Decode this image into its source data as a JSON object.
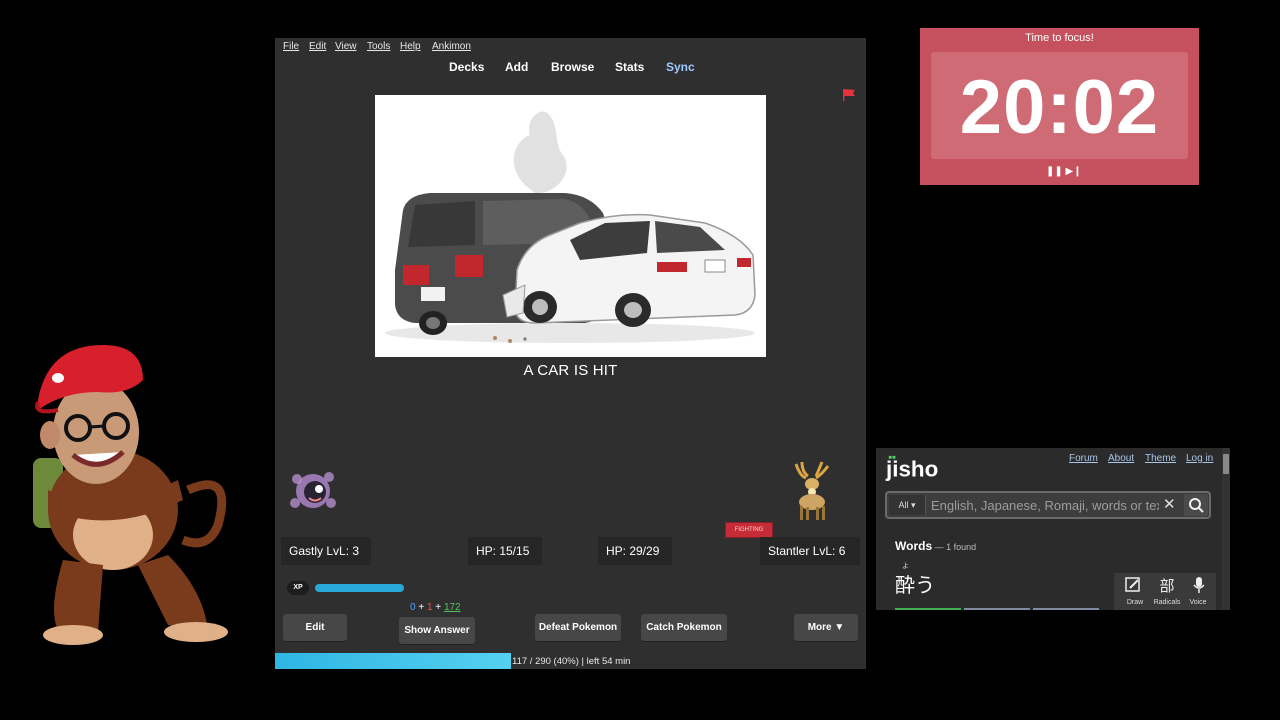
{
  "anki": {
    "menu": [
      "File",
      "Edit",
      "View",
      "Tools",
      "Help",
      "Ankimon"
    ],
    "toolbar": {
      "decks": "Decks",
      "add": "Add",
      "browse": "Browse",
      "stats": "Stats",
      "sync": "Sync"
    },
    "card_text": "A CAR IS HIT",
    "battle": {
      "player_pokemon": "Gastly LvL: 3",
      "player_hp": "HP: 15/15",
      "enemy_hp": "HP: 29/29",
      "enemy_pokemon": "Stantler LvL: 6",
      "enemy_type": "FIGHTING",
      "xp_label": "XP",
      "xp_fraction": 0.85
    },
    "counts": {
      "new": "0",
      "sep1": " + ",
      "learn": "1",
      "sep2": " + ",
      "review": "172"
    },
    "buttons": {
      "edit": "Edit",
      "show_answer": "Show Answer",
      "defeat": "Defeat Pokemon",
      "catch": "Catch Pokemon",
      "more": "More ▼"
    },
    "progress": {
      "text": "117 / 290 (40%) | left 54 min",
      "fraction": 0.4
    }
  },
  "timer": {
    "title": "Time to focus!",
    "time": "20:02",
    "controls": "❚❚ ▶❙"
  },
  "jisho": {
    "logo": "jisho",
    "links": {
      "forum": "Forum",
      "about": "About",
      "theme": "Theme",
      "login": "Log in"
    },
    "search": {
      "scope": "All ▾",
      "placeholder": "English, Japanese, Romaji, words or text"
    },
    "words_label": "Words",
    "found": " — 1 found",
    "furigana": "よ",
    "word": "酔う",
    "tools": {
      "draw": "Draw",
      "radicals": "Radicals",
      "voice": "Voice",
      "radicals_icon": "部"
    }
  },
  "colors": {
    "timer_bg": "#c4515d",
    "xp_bar": "#26a9d9",
    "progress": "#2fb6e4",
    "sync": "#9ec9ff"
  }
}
